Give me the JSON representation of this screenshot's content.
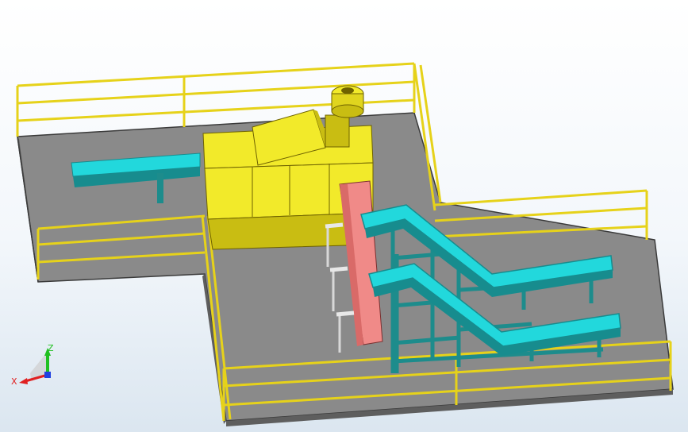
{
  "viewport": {
    "background_top": "#ffffff",
    "background_bottom": "#dbe6f0"
  },
  "colors": {
    "floor": "#8a8a8a",
    "floor_edge": "#3a3a3a",
    "railing": "#e6d21a",
    "railing_dark": "#6e6200",
    "machine": "#f2ea2a",
    "machine_shade": "#c9bd12",
    "conveyor": "#22d8dc",
    "conveyor_dark": "#178c8e",
    "frame": "#1d8c8c",
    "chute": "#f08a88",
    "post": "#d8d8d8"
  },
  "triad": {
    "x_label": "X",
    "z_label": "Z",
    "x_color": "#e02020",
    "z_color": "#20c020",
    "y_color": "#2040e0"
  }
}
